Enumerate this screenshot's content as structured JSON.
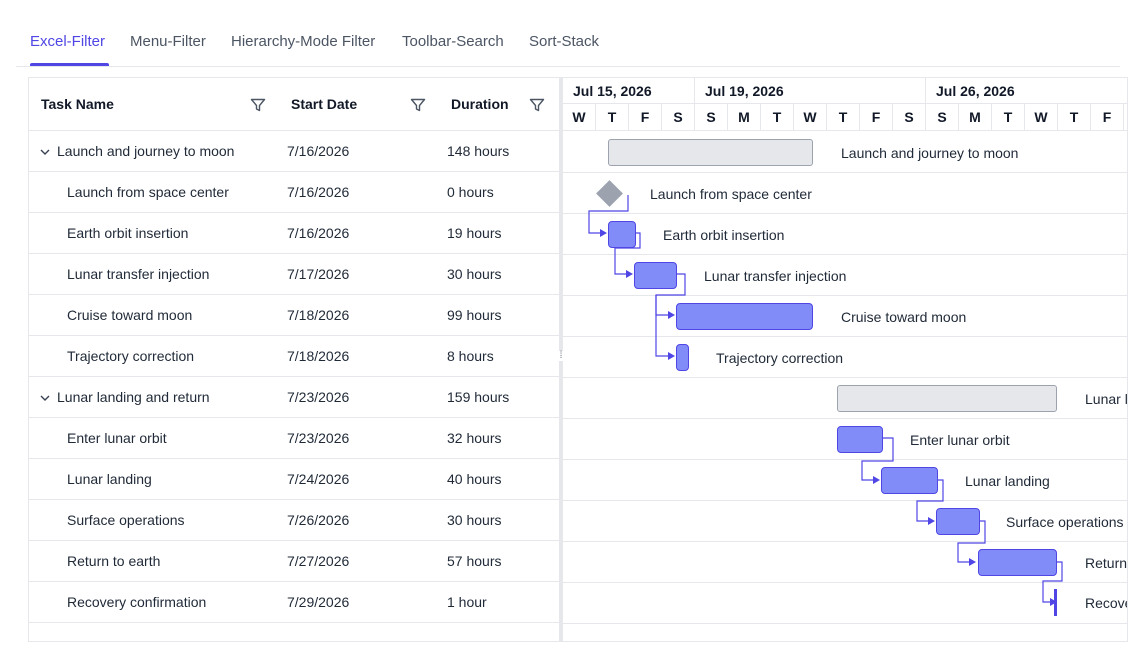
{
  "tabs": [
    {
      "label": "Excel-Filter",
      "active": true
    },
    {
      "label": "Menu-Filter",
      "active": false
    },
    {
      "label": "Hierarchy-Mode Filter",
      "active": false
    },
    {
      "label": "Toolbar-Search",
      "active": false
    },
    {
      "label": "Sort-Stack",
      "active": false
    }
  ],
  "grid": {
    "columns": [
      {
        "label": "Task Name",
        "icon": "filter-icon"
      },
      {
        "label": "Start Date",
        "icon": "filter-icon"
      },
      {
        "label": "Duration",
        "icon": "filter-icon"
      }
    ],
    "rows": [
      {
        "name": "Launch and journey to moon",
        "start": "7/16/2026",
        "duration": "148 hours",
        "summary": true,
        "expanded": true
      },
      {
        "name": "Launch from space center",
        "start": "7/16/2026",
        "duration": "0 hours"
      },
      {
        "name": "Earth orbit insertion",
        "start": "7/16/2026",
        "duration": "19 hours"
      },
      {
        "name": "Lunar transfer injection",
        "start": "7/17/2026",
        "duration": "30 hours"
      },
      {
        "name": "Cruise toward moon",
        "start": "7/18/2026",
        "duration": "99 hours"
      },
      {
        "name": "Trajectory correction",
        "start": "7/18/2026",
        "duration": "8 hours"
      },
      {
        "name": "Lunar landing and return",
        "start": "7/23/2026",
        "duration": "159 hours",
        "summary": true,
        "expanded": true
      },
      {
        "name": "Enter lunar orbit",
        "start": "7/23/2026",
        "duration": "32 hours"
      },
      {
        "name": "Lunar landing",
        "start": "7/24/2026",
        "duration": "40 hours"
      },
      {
        "name": "Surface operations",
        "start": "7/26/2026",
        "duration": "30 hours"
      },
      {
        "name": "Return to earth",
        "start": "7/27/2026",
        "duration": "57 hours"
      },
      {
        "name": "Recovery confirmation",
        "start": "7/29/2026",
        "duration": "1 hour"
      }
    ]
  },
  "timeline": {
    "weeks": [
      "Jul 15, 2026",
      "Jul 19, 2026",
      "Jul 26, 2026"
    ],
    "days": [
      "W",
      "T",
      "F",
      "S",
      "S",
      "M",
      "T",
      "W",
      "T",
      "F",
      "S",
      "S",
      "M",
      "T",
      "W",
      "T",
      "F"
    ]
  },
  "bar_labels": [
    "Launch and journey to moon",
    "Launch from space center",
    "Earth orbit insertion",
    "Lunar transfer injection",
    "Cruise toward moon",
    "Trajectory correction",
    "Lunar l",
    "Enter lunar orbit",
    "Lunar landing",
    "Surface operations",
    "Return",
    "Recove"
  ],
  "colors": {
    "accent": "#4f46e5",
    "task_bar": "#818cf8",
    "summary_bar": "#e5e7eb",
    "milestone": "#9ca3af"
  }
}
